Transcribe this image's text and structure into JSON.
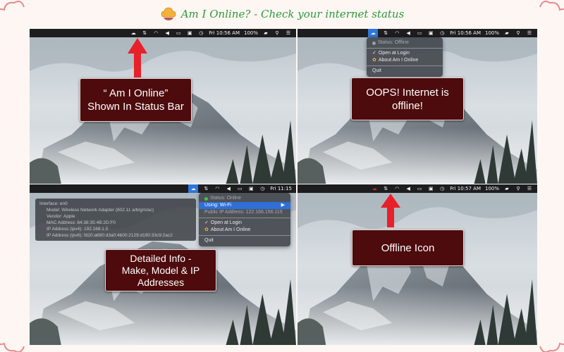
{
  "header": {
    "title": "Am I Online? - Check your internet status"
  },
  "menubar_tl": {
    "time": "Fri 10:56 AM",
    "battery": "100%"
  },
  "menubar_tr": {
    "time": "Fri 10:56 AM",
    "battery": "100%"
  },
  "menubar_bl": {
    "time": "Fri 11:15"
  },
  "menubar_br": {
    "time": "Fri 10:57 AM",
    "battery": "100%"
  },
  "callouts": {
    "status_bar": "“ Am I Online”\nShown In Status Bar",
    "offline": "OOPS! Internet is\noffline!",
    "detailed": "Detailed Info -\nMake, Model & IP\nAddresses",
    "offline_icon": "Offline Icon"
  },
  "menu_offline": {
    "status": "Status: Offline",
    "open_login": "Open at Login",
    "about": "About Am I Online",
    "quit": "Quit"
  },
  "menu_online": {
    "status": "Status: Online",
    "using": "Using: Wi-Fi",
    "public_ip": "Public IP Address: 122.166.156.115",
    "open_login": "Open at Login",
    "about": "About Am I Online",
    "quit": "Quit"
  },
  "info": {
    "interface": "Interface: en0",
    "model": "Model: Wireless Network Adapter (802.11 a/b/g/n/ac)",
    "vendor": "Vendor: Apple",
    "mac": "MAC Address: 84:38:35:4B:2D:F0",
    "ipv4": "IP Address (ipv4): 192.168.1.5",
    "ipv6": "IP Address (ipv6): fd20:a680:d3a0:4b00:2129:d190:33c9:2ac2"
  },
  "colors": {
    "callout_bg": "#4d0b0d",
    "arrow": "#e8202a",
    "title": "#2e9a3b",
    "menubar": "#1d1d1f",
    "highlight": "#2f6fd6"
  },
  "icons": [
    "cloud-logo-icon",
    "cloud-status-icon",
    "cloud-offline-icon",
    "transfer-icon",
    "wifi-icon",
    "volume-icon",
    "airplay-icon",
    "display-icon",
    "time-machine-icon",
    "battery-icon",
    "spotlight-icon",
    "list-icon",
    "checkmark-icon",
    "star-icon",
    "submenu-arrow-icon",
    "green-dot-icon",
    "grey-dot-icon"
  ]
}
